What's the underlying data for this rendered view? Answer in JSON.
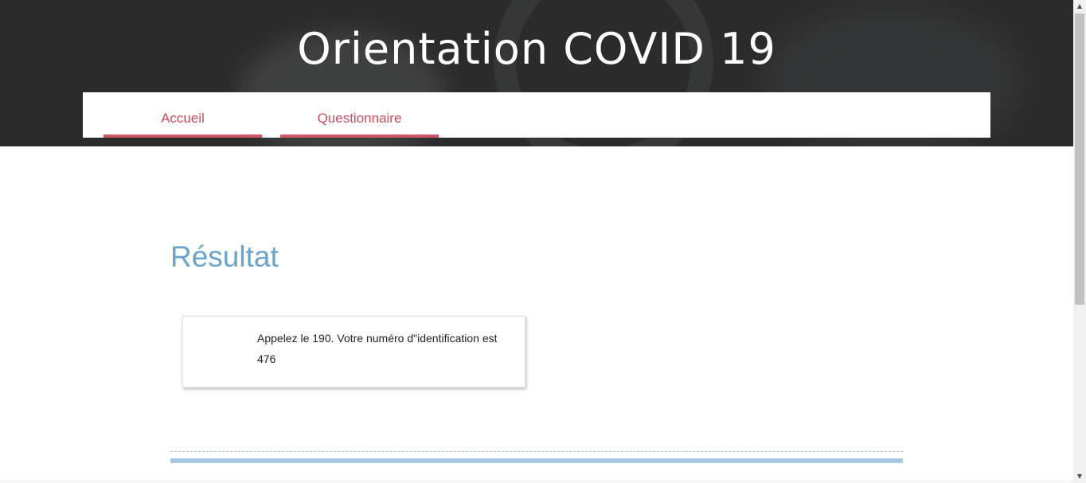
{
  "header": {
    "title": "Orientation COVID 19",
    "background_color": "#2b2b2b"
  },
  "nav": {
    "items": [
      {
        "label": "Accueil"
      },
      {
        "label": "Questionnaire"
      }
    ],
    "accent_color": "#cc4b5c"
  },
  "main": {
    "heading": "Résultat",
    "heading_color": "#6aa3cc",
    "result_message": "Appelez le 190. Votre numéro d\"identification est 476"
  },
  "scrollbar": {
    "up_icon": "triangle-up-icon",
    "down_icon": "triangle-down-icon"
  }
}
